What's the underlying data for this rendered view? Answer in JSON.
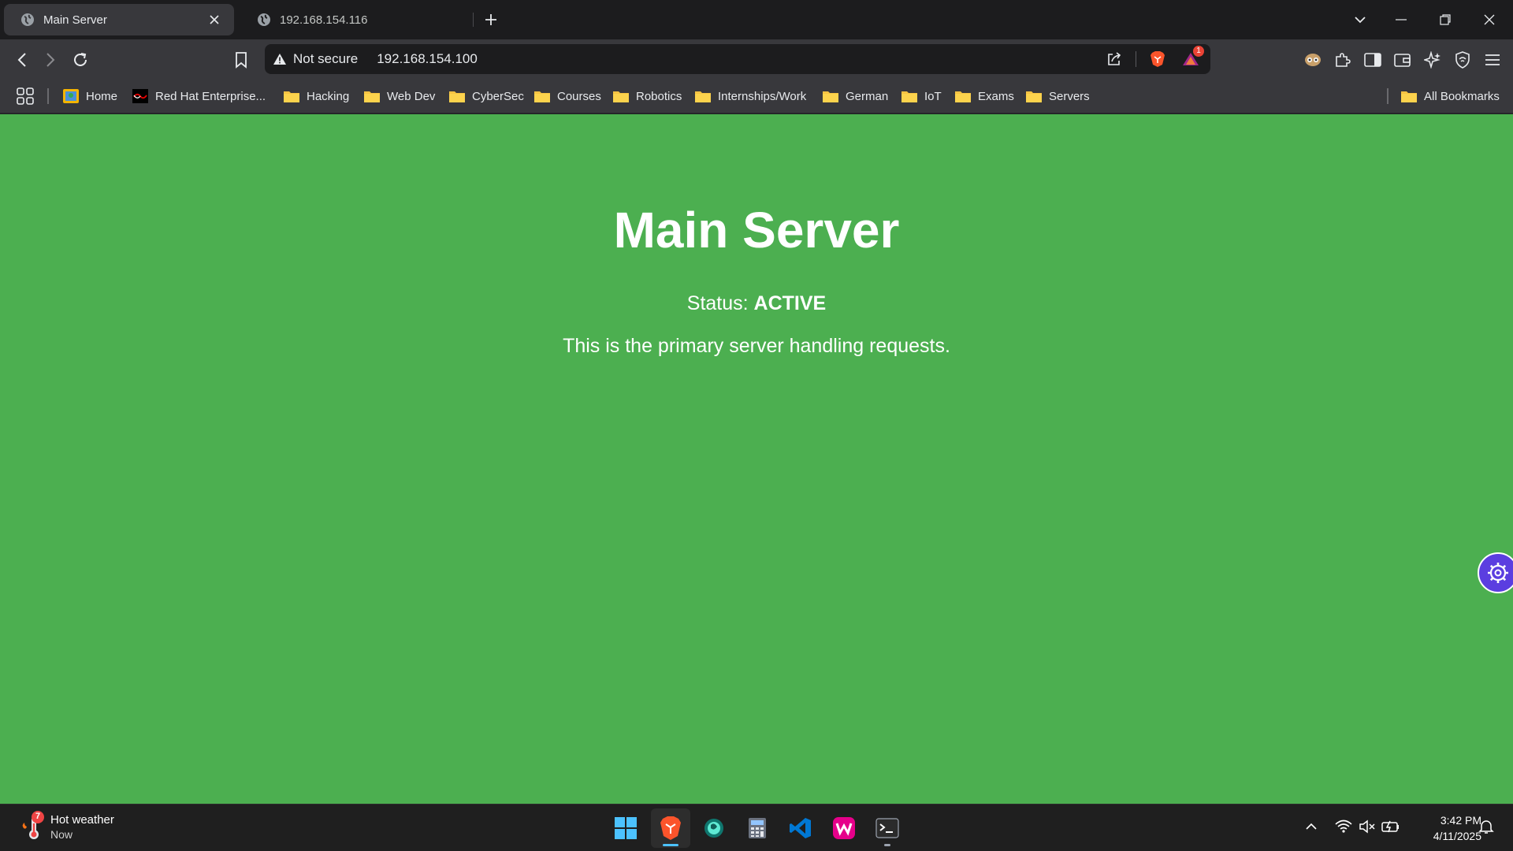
{
  "browser": {
    "tabs": [
      {
        "title": "Main Server",
        "active": true
      },
      {
        "title": "192.168.154.116",
        "active": false
      }
    ],
    "address_bar": {
      "security_label": "Not secure",
      "url": "192.168.154.100"
    },
    "shields_badge": "1",
    "bookmarks": [
      {
        "label": "Home",
        "icon": "home-bookmark-icon"
      },
      {
        "label": "Red Hat Enterprise...",
        "icon": "redhat-icon"
      },
      {
        "label": "Hacking",
        "icon": "folder-icon"
      },
      {
        "label": "Web Dev",
        "icon": "folder-icon"
      },
      {
        "label": "CyberSec",
        "icon": "folder-icon"
      },
      {
        "label": "Courses",
        "icon": "folder-icon"
      },
      {
        "label": "Robotics",
        "icon": "folder-icon"
      },
      {
        "label": "Internships/Work",
        "icon": "folder-icon"
      },
      {
        "label": "German",
        "icon": "folder-icon"
      },
      {
        "label": "IoT",
        "icon": "folder-icon"
      },
      {
        "label": "Exams",
        "icon": "folder-icon"
      },
      {
        "label": "Servers",
        "icon": "folder-icon"
      }
    ],
    "all_bookmarks_label": "All Bookmarks"
  },
  "page": {
    "background": "#4caf50",
    "heading": "Main Server",
    "status_label": "Status:",
    "status_value": "ACTIVE",
    "description": "This is the primary server handling requests."
  },
  "taskbar": {
    "weather": {
      "badge": "7",
      "title": "Hot weather",
      "subtitle": "Now"
    },
    "apps": [
      "start-button",
      "brave-browser",
      "app-globe",
      "calculator",
      "vs-code",
      "wamp-server",
      "terminal"
    ],
    "clock": {
      "time": "3:42 PM",
      "date": "4/11/2025"
    }
  }
}
